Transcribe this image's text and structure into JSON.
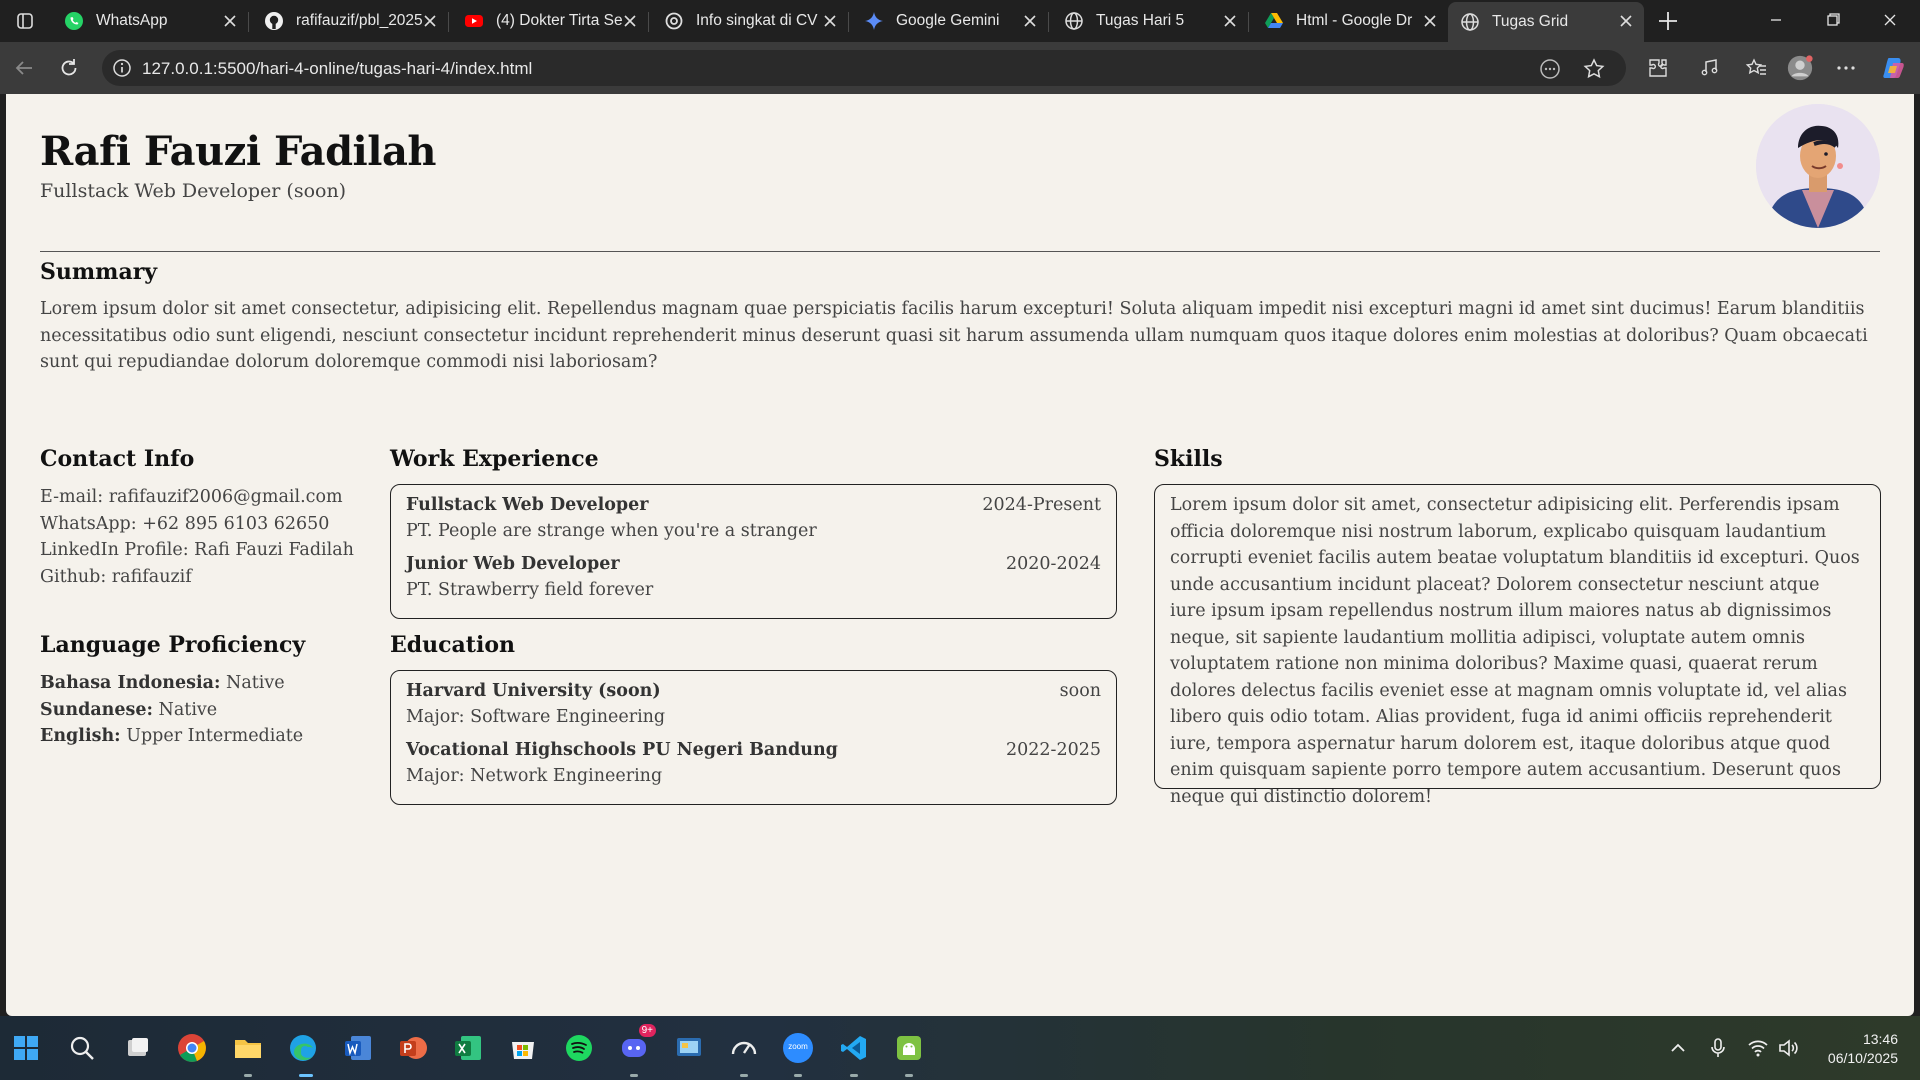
{
  "browser": {
    "tabs": [
      {
        "title": "WhatsApp",
        "icon": "whatsapp-icon",
        "active": false
      },
      {
        "title": "rafifauzif/pbl_2025",
        "icon": "github-icon",
        "active": false
      },
      {
        "title": "(4) Dokter Tirta Se",
        "icon": "youtube-icon",
        "active": false
      },
      {
        "title": "Info singkat di CV",
        "icon": "chatgpt-icon",
        "active": false
      },
      {
        "title": "Google Gemini",
        "icon": "gemini-icon",
        "active": false
      },
      {
        "title": "Tugas Hari 5",
        "icon": "globe-icon",
        "active": false
      },
      {
        "title": "Html - Google Dr",
        "icon": "google-drive-icon",
        "active": false
      },
      {
        "title": "Tugas Grid",
        "icon": "globe-icon",
        "active": true
      }
    ],
    "url": "127.0.0.1:5500/hari-4-online/tugas-hari-4/index.html"
  },
  "page": {
    "name": "Rafi Fauzi Fadilah",
    "role": "Fullstack Web Developer (soon)",
    "summary": {
      "heading": "Summary",
      "text": "Lorem ipsum dolor sit amet consectetur, adipisicing elit. Repellendus magnam quae perspiciatis facilis harum excepturi! Soluta aliquam impedit nisi excepturi magni id amet sint ducimus! Earum blanditiis necessitatibus odio sunt eligendi, nesciunt consectetur incidunt reprehenderit minus deserunt quasi sit harum assumenda ullam numquam quos itaque dolores enim molestias at doloribus? Quam obcaecati sunt qui repudiandae dolorum doloremque commodi nisi laboriosam?"
    },
    "contact": {
      "heading": "Contact Info",
      "lines": [
        "E-mail: rafifauzif2006@gmail.com",
        "WhatsApp: +62 895 6103 62650",
        "LinkedIn Profile: Rafi Fauzi Fadilah",
        "Github: rafifauzif"
      ]
    },
    "languages": {
      "heading": "Language Proficiency",
      "items": [
        {
          "lang": "Bahasa Indonesia:",
          "level": "Native"
        },
        {
          "lang": "Sundanese:",
          "level": "Native"
        },
        {
          "lang": "English:",
          "level": "Upper Intermediate"
        }
      ]
    },
    "work": {
      "heading": "Work Experience",
      "items": [
        {
          "title": "Fullstack Web Developer",
          "date": "2024-Present",
          "sub": "PT. People are strange when you're a stranger"
        },
        {
          "title": "Junior Web Developer",
          "date": "2020-2024",
          "sub": "PT. Strawberry field forever"
        }
      ]
    },
    "education": {
      "heading": "Education",
      "items": [
        {
          "title": "Harvard University (soon)",
          "date": "soon",
          "sub": "Major: Software Engineering"
        },
        {
          "title": "Vocational Highschools PU Negeri Bandung",
          "date": "2022-2025",
          "sub": "Major: Network Engineering"
        }
      ]
    },
    "skills": {
      "heading": "Skills",
      "text": "Lorem ipsum dolor sit amet, consectetur adipisicing elit. Perferendis ipsam officia doloremque nisi nostrum laborum, explicabo quisquam laudantium corrupti eveniet facilis autem beatae voluptatum blanditiis id excepturi. Quos unde accusantium incidunt placeat? Dolorem consectetur nesciunt atque iure ipsum ipsam repellendus nostrum illum maiores natus ab dignissimos neque, sit sapiente laudantium mollitia adipisci, voluptate autem omnis voluptatem ratione non minima doloribus? Maxime quasi, quaerat rerum dolores delectus facilis eveniet esse at magnam omnis voluptate id, vel alias libero quis odio totam. Alias provident, fuga id animi officiis reprehenderit iure, tempora aspernatur harum dolorem est, itaque doloribus atque quod enim quisquam sapiente porro tempore autem accusantium. Deserunt quos neque qui distinctio dolorem!"
    }
  },
  "taskbar": {
    "notification_badge": "9+",
    "zoom_label": "zoom",
    "time": "13:46",
    "date": "06/10/2025"
  }
}
